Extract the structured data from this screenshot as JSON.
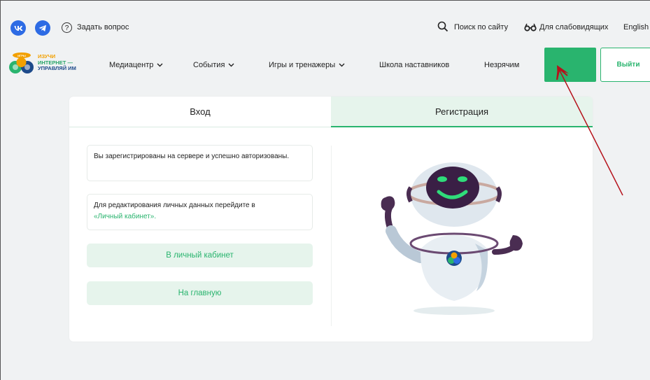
{
  "top_bar": {
    "ask_question": "Задать вопрос",
    "site_search": "Поиск по сайту",
    "accessibility": "Для слабовидящих",
    "language": "English"
  },
  "logo": {
    "badge": "ИГРЫ",
    "line1": "ИЗУЧИ",
    "line2": "ИНТЕРНЕТ —",
    "line3": "УПРАВЛЯЙ ИМ"
  },
  "nav": {
    "items": [
      {
        "label": "Медиацентр",
        "dropdown": true
      },
      {
        "label": "События",
        "dropdown": true
      },
      {
        "label": "Игры и тренажеры",
        "dropdown": true
      },
      {
        "label": "Школа наставников",
        "dropdown": false
      },
      {
        "label": "Незрячим",
        "dropdown": false
      }
    ],
    "logout": "Выйти"
  },
  "tabs": {
    "login": "Вход",
    "register": "Регистрация"
  },
  "messages": {
    "auth_success": "Вы зарегистрированы на сервере и успешно авторизованы.",
    "edit_hint": "Для редактирования личных данных перейдите в",
    "cabinet_link": "«Личный кабинет»."
  },
  "buttons": {
    "to_cabinet": "В личный кабинет",
    "to_home": "На главную"
  },
  "colors": {
    "accent": "#29b46e",
    "accent_light": "#e6f4ec",
    "social": "#2d6be4",
    "annotation_arrow": "#b5121b"
  }
}
